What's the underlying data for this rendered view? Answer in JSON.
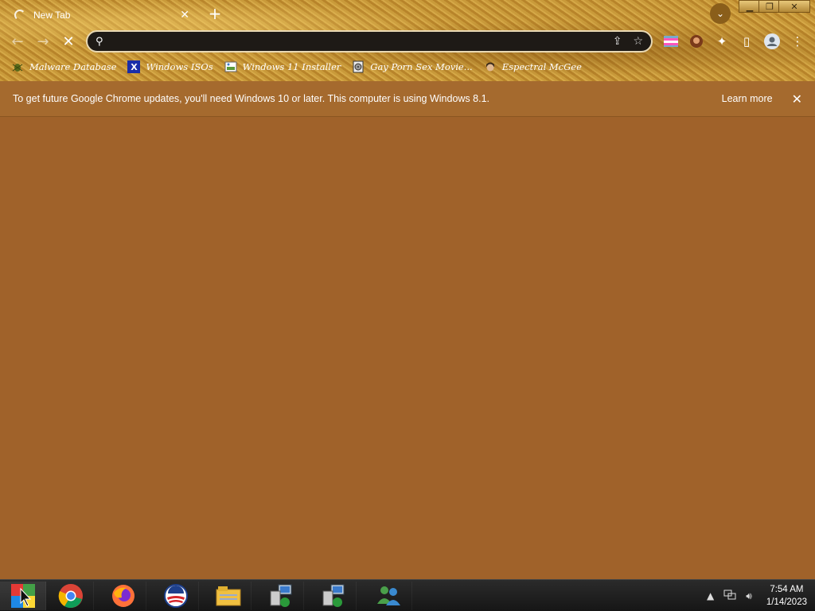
{
  "browser": {
    "tab": {
      "title": "New Tab",
      "close_glyph": "✕"
    },
    "new_tab_glyph": "+",
    "tab_search_glyph": "⌄",
    "window_controls": {
      "minimize": "▁",
      "restore": "❐",
      "close": "✕"
    },
    "nav": {
      "back": "←",
      "forward": "→",
      "stop": "✕"
    },
    "omnibox": {
      "value": "",
      "placeholder": ""
    },
    "omnibox_icons": {
      "search": "⚲",
      "share": "⇪",
      "bookmark": "☆"
    },
    "toolbar_icons": {
      "extensions": "✦",
      "side_panel": "▯",
      "profile": "●",
      "menu": "⋮"
    }
  },
  "bookmarks": [
    {
      "label": "Malware Database",
      "icon": "bug-icon"
    },
    {
      "label": "Windows ISOs",
      "icon": "x-logo-icon"
    },
    {
      "label": "Windows 11 Installer",
      "icon": "picture-icon"
    },
    {
      "label": "Gay Porn Sex Movie...",
      "icon": "disc-icon"
    },
    {
      "label": "Espectral McGee",
      "icon": "face-icon"
    }
  ],
  "infobar": {
    "message": "To get future Google Chrome updates, you'll need Windows 10 or later. This computer is using Windows 8.1.",
    "learn_more": "Learn more",
    "close_glyph": "✕"
  },
  "taskbar": {
    "apps": [
      {
        "name": "start",
        "active": true
      },
      {
        "name": "chrome"
      },
      {
        "name": "firefox"
      },
      {
        "name": "obama-campaign"
      },
      {
        "name": "file-explorer"
      },
      {
        "name": "network-setup-1"
      },
      {
        "name": "network-setup-2"
      },
      {
        "name": "messenger"
      }
    ],
    "clock": {
      "time": "7:54 AM",
      "date": "1/14/2023"
    }
  },
  "colors": {
    "page_bg": "#a0622a",
    "infobar_bg": "#a56a2e",
    "taskbar_bg": "#1e1e1e"
  }
}
